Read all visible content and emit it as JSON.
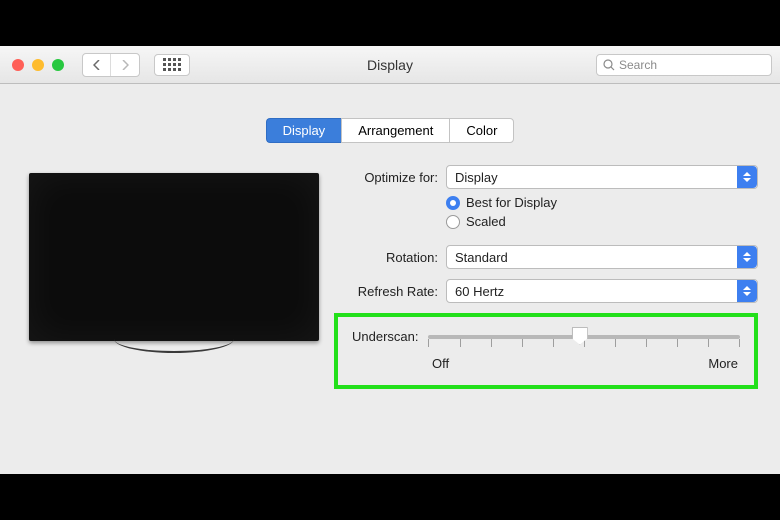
{
  "window": {
    "title": "Display",
    "search_placeholder": "Search"
  },
  "tabs": {
    "display": "Display",
    "arrangement": "Arrangement",
    "color": "Color"
  },
  "controls": {
    "optimize_label": "Optimize for:",
    "optimize_value": "Display",
    "radio_best": "Best for Display",
    "radio_scaled": "Scaled",
    "rotation_label": "Rotation:",
    "rotation_value": "Standard",
    "refresh_label": "Refresh Rate:",
    "refresh_value": "60 Hertz",
    "underscan_label": "Underscan:",
    "underscan_min": "Off",
    "underscan_max": "More"
  }
}
